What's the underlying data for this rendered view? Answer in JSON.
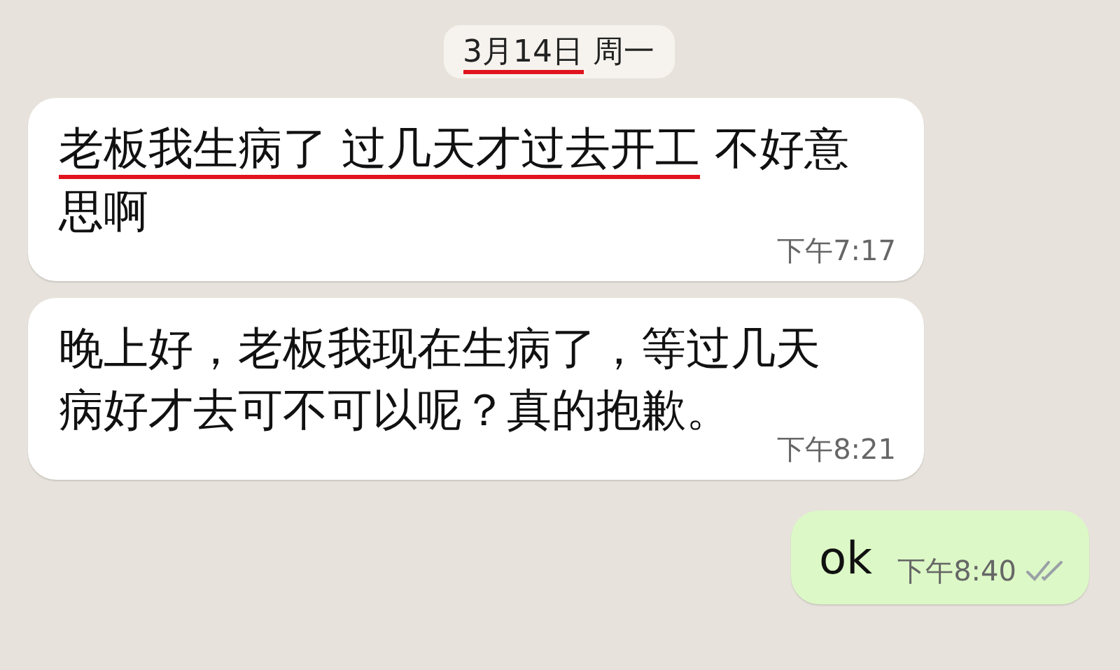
{
  "date_chip": {
    "parts": [
      {
        "text": "3月14日",
        "underlined": true
      },
      {
        "text": " 周一",
        "underlined": false
      }
    ]
  },
  "messages": [
    {
      "kind": "incoming",
      "parts": [
        {
          "text": "老板我生病了 过几天才过去开工",
          "underlined": true
        },
        {
          "text": " 不好意思啊",
          "underlined": false
        }
      ],
      "time": "下午7:17"
    },
    {
      "kind": "incoming",
      "parts": [
        {
          "text": "晚上好，老板我现在生病了，等过几天病好才去可不可以呢？真的抱歉。",
          "underlined": false
        }
      ],
      "time": "下午8:21"
    },
    {
      "kind": "outgoing",
      "parts": [
        {
          "text": "ok",
          "underlined": false
        }
      ],
      "time": "下午8:40",
      "read": false
    }
  ]
}
